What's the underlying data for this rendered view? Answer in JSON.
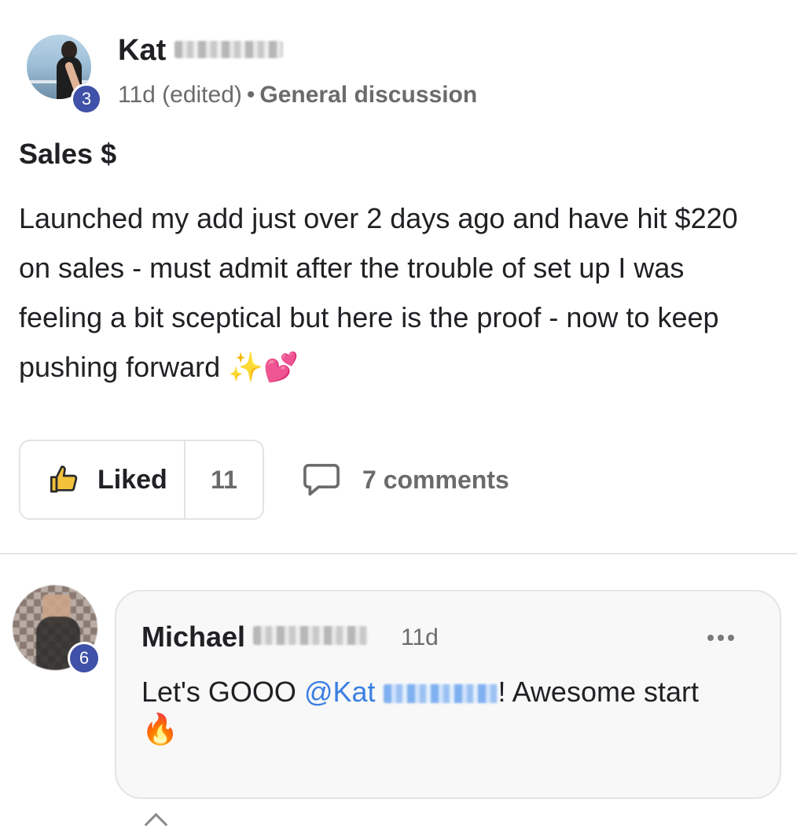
{
  "post": {
    "author_first": "Kat",
    "level": "3",
    "time": "11d (edited)",
    "separator": "•",
    "category": "General discussion",
    "title": "Sales $",
    "body": "Launched my add just over 2 days ago and have hit $220 on sales - must admit after the trouble of set up I was feeling a bit sceptical but here is the proof - now to keep pushing forward ",
    "emoji_sparkles": "✨",
    "emoji_hearts": "💕",
    "like_label": "Liked",
    "like_count": "11",
    "comments_label": "7 comments"
  },
  "comment": {
    "author_first": "Michael",
    "level": "6",
    "time": "11d",
    "text_before": "Let's GOOO ",
    "mention": "@Kat",
    "text_after": "! Awesome start",
    "emoji_fire": "🔥"
  },
  "colors": {
    "badge": "#3f51a8",
    "mention": "#3b7fe3",
    "muted": "#6b6b6b"
  },
  "icons": [
    "thumbs-up-icon",
    "comment-bubble-icon",
    "more-options-icon"
  ]
}
